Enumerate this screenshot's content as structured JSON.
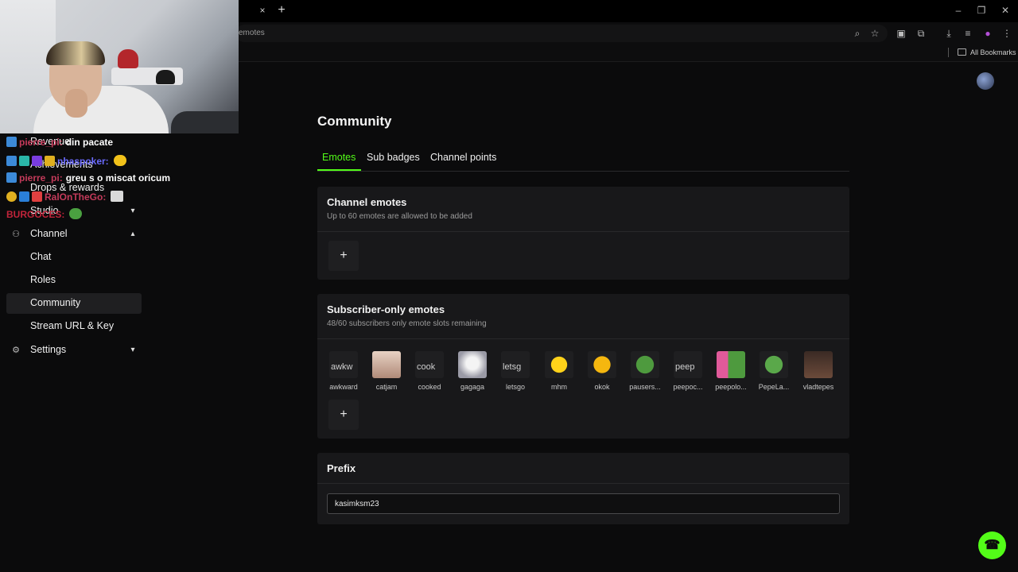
{
  "browser": {
    "tab_close": "×",
    "new_tab": "+",
    "address": "emotes",
    "window_controls": [
      "–",
      "❐",
      "✕"
    ],
    "bookmarks_label": "All Bookmarks"
  },
  "chat": [
    {
      "user": "pierre_pi:",
      "user_color": "#c43a5a",
      "message": "din pacate"
    },
    {
      "user": "nhaspoker:",
      "user_color": "#6b6bff",
      "message": ""
    },
    {
      "user": "pierre_pi:",
      "user_color": "#c43a5a",
      "message": "greu s o miscat oricum"
    },
    {
      "user": "RalOnTheGo:",
      "user_color": "#c43a5a",
      "message": ""
    },
    {
      "user": "BURGOCES:",
      "user_color": "#c0243a",
      "message": ""
    }
  ],
  "sidebar": {
    "items": [
      {
        "label": "Revenue"
      },
      {
        "label": "Achievements"
      },
      {
        "label": "Drops & rewards"
      },
      {
        "label": "Studio",
        "chevron": "▾"
      },
      {
        "label": "Channel",
        "chevron": "▴",
        "icon": "people-icon"
      },
      {
        "label": "Chat"
      },
      {
        "label": "Roles"
      },
      {
        "label": "Community",
        "active": true
      },
      {
        "label": "Stream URL & Key"
      },
      {
        "label": "Settings",
        "chevron": "▾",
        "icon": "gear-icon"
      }
    ]
  },
  "page": {
    "title": "Community",
    "tabs": [
      "Emotes",
      "Sub badges",
      "Channel points"
    ],
    "active_tab": "Emotes"
  },
  "channel_emotes": {
    "title": "Channel emotes",
    "subtitle": "Up to 60 emotes are allowed to be added",
    "add_label": "+"
  },
  "subscriber_emotes": {
    "title": "Subscriber-only emotes",
    "subtitle": "48/60 subscribers only emote slots remaining",
    "add_label": "+",
    "emotes": [
      {
        "name": "awkward",
        "alt": "awkw"
      },
      {
        "name": "catjam",
        "alt": ""
      },
      {
        "name": "cooked",
        "alt": "cook"
      },
      {
        "name": "gagaga",
        "alt": ""
      },
      {
        "name": "letsgo",
        "alt": "letsg"
      },
      {
        "name": "mhm",
        "alt": ""
      },
      {
        "name": "okok",
        "alt": ""
      },
      {
        "name": "pausers...",
        "alt": ""
      },
      {
        "name": "peepoc...",
        "alt": "peep"
      },
      {
        "name": "peepolo...",
        "alt": ""
      },
      {
        "name": "PepeLa...",
        "alt": ""
      },
      {
        "name": "vladtepes",
        "alt": ""
      }
    ]
  },
  "prefix": {
    "title": "Prefix",
    "value": "kasimksm23"
  },
  "colors": {
    "accent": "#53fc18",
    "card": "#18181a",
    "background": "#0b0b0c"
  }
}
